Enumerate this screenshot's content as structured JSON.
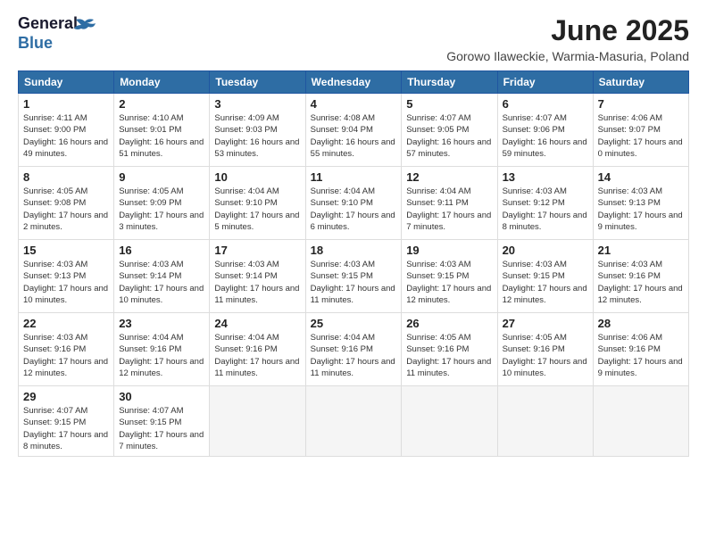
{
  "header": {
    "logo_line1": "General",
    "logo_line2": "Blue",
    "month_title": "June 2025",
    "location": "Gorowo Ilaweckie, Warmia-Masuria, Poland"
  },
  "weekdays": [
    "Sunday",
    "Monday",
    "Tuesday",
    "Wednesday",
    "Thursday",
    "Friday",
    "Saturday"
  ],
  "days": [
    {
      "day": "",
      "sunrise": "",
      "sunset": "",
      "daylight": "",
      "empty": true
    },
    {
      "day": "1",
      "sunrise": "Sunrise: 4:11 AM",
      "sunset": "Sunset: 9:00 PM",
      "daylight": "Daylight: 16 hours and 49 minutes."
    },
    {
      "day": "2",
      "sunrise": "Sunrise: 4:10 AM",
      "sunset": "Sunset: 9:01 PM",
      "daylight": "Daylight: 16 hours and 51 minutes."
    },
    {
      "day": "3",
      "sunrise": "Sunrise: 4:09 AM",
      "sunset": "Sunset: 9:03 PM",
      "daylight": "Daylight: 16 hours and 53 minutes."
    },
    {
      "day": "4",
      "sunrise": "Sunrise: 4:08 AM",
      "sunset": "Sunset: 9:04 PM",
      "daylight": "Daylight: 16 hours and 55 minutes."
    },
    {
      "day": "5",
      "sunrise": "Sunrise: 4:07 AM",
      "sunset": "Sunset: 9:05 PM",
      "daylight": "Daylight: 16 hours and 57 minutes."
    },
    {
      "day": "6",
      "sunrise": "Sunrise: 4:07 AM",
      "sunset": "Sunset: 9:06 PM",
      "daylight": "Daylight: 16 hours and 59 minutes."
    },
    {
      "day": "7",
      "sunrise": "Sunrise: 4:06 AM",
      "sunset": "Sunset: 9:07 PM",
      "daylight": "Daylight: 17 hours and 0 minutes."
    },
    {
      "day": "8",
      "sunrise": "Sunrise: 4:05 AM",
      "sunset": "Sunset: 9:08 PM",
      "daylight": "Daylight: 17 hours and 2 minutes."
    },
    {
      "day": "9",
      "sunrise": "Sunrise: 4:05 AM",
      "sunset": "Sunset: 9:09 PM",
      "daylight": "Daylight: 17 hours and 3 minutes."
    },
    {
      "day": "10",
      "sunrise": "Sunrise: 4:04 AM",
      "sunset": "Sunset: 9:10 PM",
      "daylight": "Daylight: 17 hours and 5 minutes."
    },
    {
      "day": "11",
      "sunrise": "Sunrise: 4:04 AM",
      "sunset": "Sunset: 9:10 PM",
      "daylight": "Daylight: 17 hours and 6 minutes."
    },
    {
      "day": "12",
      "sunrise": "Sunrise: 4:04 AM",
      "sunset": "Sunset: 9:11 PM",
      "daylight": "Daylight: 17 hours and 7 minutes."
    },
    {
      "day": "13",
      "sunrise": "Sunrise: 4:03 AM",
      "sunset": "Sunset: 9:12 PM",
      "daylight": "Daylight: 17 hours and 8 minutes."
    },
    {
      "day": "14",
      "sunrise": "Sunrise: 4:03 AM",
      "sunset": "Sunset: 9:13 PM",
      "daylight": "Daylight: 17 hours and 9 minutes."
    },
    {
      "day": "15",
      "sunrise": "Sunrise: 4:03 AM",
      "sunset": "Sunset: 9:13 PM",
      "daylight": "Daylight: 17 hours and 10 minutes."
    },
    {
      "day": "16",
      "sunrise": "Sunrise: 4:03 AM",
      "sunset": "Sunset: 9:14 PM",
      "daylight": "Daylight: 17 hours and 10 minutes."
    },
    {
      "day": "17",
      "sunrise": "Sunrise: 4:03 AM",
      "sunset": "Sunset: 9:14 PM",
      "daylight": "Daylight: 17 hours and 11 minutes."
    },
    {
      "day": "18",
      "sunrise": "Sunrise: 4:03 AM",
      "sunset": "Sunset: 9:15 PM",
      "daylight": "Daylight: 17 hours and 11 minutes."
    },
    {
      "day": "19",
      "sunrise": "Sunrise: 4:03 AM",
      "sunset": "Sunset: 9:15 PM",
      "daylight": "Daylight: 17 hours and 12 minutes."
    },
    {
      "day": "20",
      "sunrise": "Sunrise: 4:03 AM",
      "sunset": "Sunset: 9:15 PM",
      "daylight": "Daylight: 17 hours and 12 minutes."
    },
    {
      "day": "21",
      "sunrise": "Sunrise: 4:03 AM",
      "sunset": "Sunset: 9:16 PM",
      "daylight": "Daylight: 17 hours and 12 minutes."
    },
    {
      "day": "22",
      "sunrise": "Sunrise: 4:03 AM",
      "sunset": "Sunset: 9:16 PM",
      "daylight": "Daylight: 17 hours and 12 minutes."
    },
    {
      "day": "23",
      "sunrise": "Sunrise: 4:04 AM",
      "sunset": "Sunset: 9:16 PM",
      "daylight": "Daylight: 17 hours and 12 minutes."
    },
    {
      "day": "24",
      "sunrise": "Sunrise: 4:04 AM",
      "sunset": "Sunset: 9:16 PM",
      "daylight": "Daylight: 17 hours and 11 minutes."
    },
    {
      "day": "25",
      "sunrise": "Sunrise: 4:04 AM",
      "sunset": "Sunset: 9:16 PM",
      "daylight": "Daylight: 17 hours and 11 minutes."
    },
    {
      "day": "26",
      "sunrise": "Sunrise: 4:05 AM",
      "sunset": "Sunset: 9:16 PM",
      "daylight": "Daylight: 17 hours and 11 minutes."
    },
    {
      "day": "27",
      "sunrise": "Sunrise: 4:05 AM",
      "sunset": "Sunset: 9:16 PM",
      "daylight": "Daylight: 17 hours and 10 minutes."
    },
    {
      "day": "28",
      "sunrise": "Sunrise: 4:06 AM",
      "sunset": "Sunset: 9:16 PM",
      "daylight": "Daylight: 17 hours and 9 minutes."
    },
    {
      "day": "29",
      "sunrise": "Sunrise: 4:07 AM",
      "sunset": "Sunset: 9:15 PM",
      "daylight": "Daylight: 17 hours and 8 minutes."
    },
    {
      "day": "30",
      "sunrise": "Sunrise: 4:07 AM",
      "sunset": "Sunset: 9:15 PM",
      "daylight": "Daylight: 17 hours and 7 minutes."
    },
    {
      "day": "",
      "sunrise": "",
      "sunset": "",
      "daylight": "",
      "empty": true
    },
    {
      "day": "",
      "sunrise": "",
      "sunset": "",
      "daylight": "",
      "empty": true
    },
    {
      "day": "",
      "sunrise": "",
      "sunset": "",
      "daylight": "",
      "empty": true
    },
    {
      "day": "",
      "sunrise": "",
      "sunset": "",
      "daylight": "",
      "empty": true
    },
    {
      "day": "",
      "sunrise": "",
      "sunset": "",
      "daylight": "",
      "empty": true
    }
  ]
}
